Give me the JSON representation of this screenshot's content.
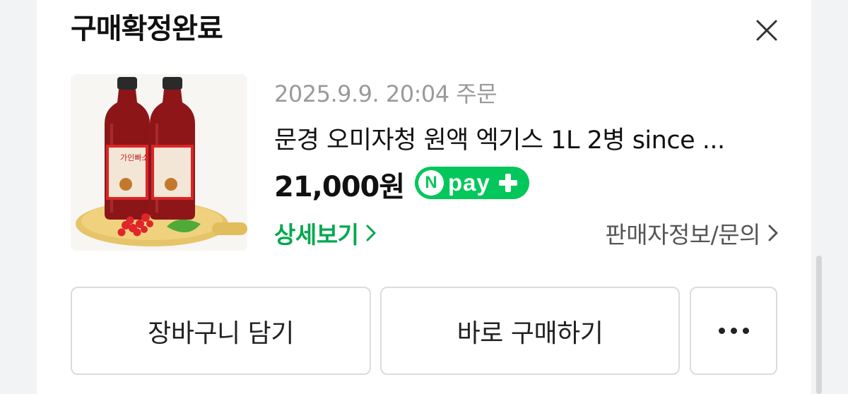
{
  "header": {
    "title": "구매확정완료"
  },
  "product": {
    "order_date": "2025.9.9. 20:04 주문",
    "name": "문경 오미자청 원액 엑기스 1L 2병 since ...",
    "price": "21,000원",
    "bottle_label": "가인빠소"
  },
  "npay_badge": {
    "n": "N",
    "pay": "pay"
  },
  "links": {
    "detail": "상세보기",
    "seller": "판매자정보/문의"
  },
  "buttons": {
    "cart": "장바구니 담기",
    "buy": "바로 구매하기"
  },
  "colors": {
    "brand_green": "#03c75a",
    "link_green": "#03a84e"
  }
}
